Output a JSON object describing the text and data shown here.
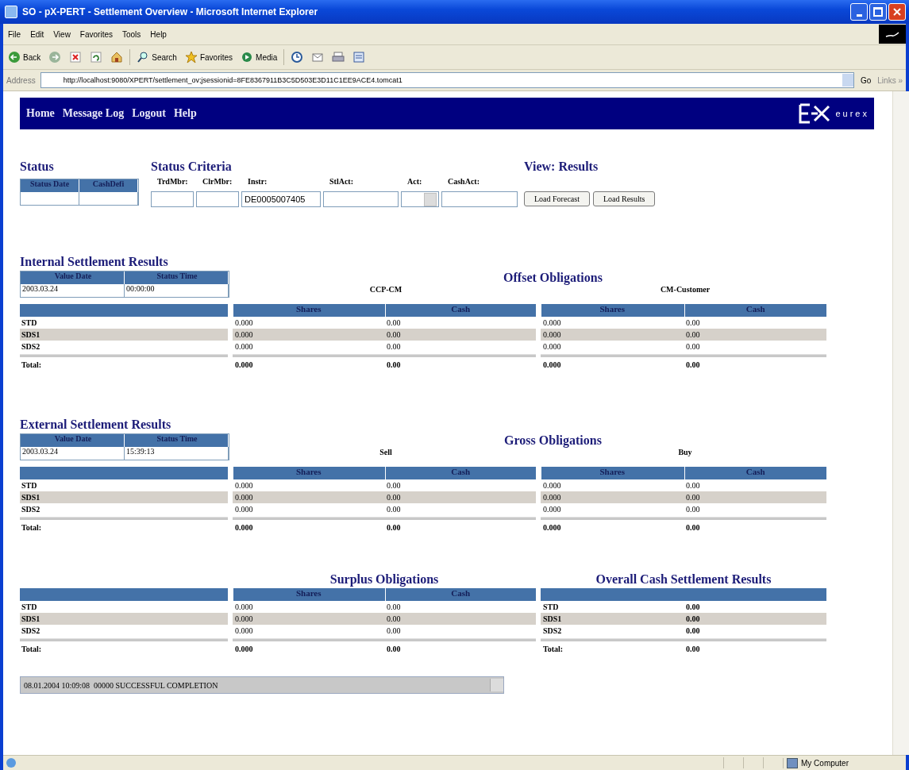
{
  "window": {
    "title": "SO - pX-PERT - Settlement Overview - Microsoft Internet Explorer"
  },
  "menu_bar": [
    "File",
    "Edit",
    "View",
    "Favorites",
    "Tools",
    "Help"
  ],
  "toolbar": [
    {
      "kind": "back",
      "label": "Back"
    },
    {
      "kind": "forward"
    },
    {
      "kind": "stop"
    },
    {
      "kind": "refresh"
    },
    {
      "kind": "home"
    },
    {
      "kind": "search",
      "label": "Search"
    },
    {
      "kind": "favorites",
      "label": "Favorites"
    },
    {
      "kind": "media",
      "label": "Media"
    },
    {
      "kind": "history"
    },
    {
      "kind": "mail"
    },
    {
      "kind": "print"
    },
    {
      "kind": "edit"
    }
  ],
  "address_bar": {
    "label": "Address",
    "url": "http://localhost:9080/XPERT/settlement_ov;jsessionid=8FE8367911B3C5D503E3D11C1EE9ACE4.tomcat1",
    "go": "Go",
    "links": "Links »"
  },
  "nav": {
    "items": [
      "Home",
      "Message Log",
      "Logout",
      "Help"
    ],
    "logo": "eurex"
  },
  "status": {
    "title": "Status",
    "columns": [
      "Status Date",
      "CashDefi"
    ]
  },
  "criteria": {
    "title": "Status Criteria",
    "fields": [
      {
        "kind": "text",
        "label": "TrdMbr:"
      },
      {
        "kind": "text",
        "label": "ClrMbr:"
      },
      {
        "kind": "text",
        "label": "Instr:",
        "value": "DE0005007405"
      },
      {
        "kind": "text",
        "label": "StlAct:"
      },
      {
        "kind": "select",
        "label": "Act:"
      },
      {
        "kind": "text",
        "label": "CashAct:"
      }
    ]
  },
  "view": {
    "title": "View: Results",
    "buttons": [
      "Load Forecast",
      "Load Results"
    ]
  },
  "sections": [
    {
      "title": "Internal Settlement Results",
      "info": {
        "columns": [
          "Value Date",
          "Status Time"
        ],
        "values": [
          "2003.03.24",
          "00:00:00"
        ]
      },
      "obligations_title": "Offset Obligations",
      "groups": [
        {
          "name": "CCP-CM",
          "columns": [
            "Shares",
            "Cash"
          ]
        },
        {
          "name": "CM-Customer",
          "columns": [
            "Shares",
            "Cash"
          ]
        }
      ],
      "rows": [
        {
          "label": "STD",
          "values": [
            "0.000",
            "0.00",
            "0.000",
            "0.00"
          ]
        },
        {
          "label": "SDS1",
          "values": [
            "0.000",
            "0.00",
            "0.000",
            "0.00"
          ]
        },
        {
          "label": "SDS2",
          "values": [
            "0.000",
            "0.00",
            "0.000",
            "0.00"
          ]
        }
      ],
      "total": {
        "label": "Total:",
        "values": [
          "0.000",
          "0.00",
          "0.000",
          "0.00"
        ]
      }
    },
    {
      "title": "External Settlement Results",
      "info": {
        "columns": [
          "Value Date",
          "Status Time"
        ],
        "values": [
          "2003.03.24",
          "15:39:13"
        ]
      },
      "obligations_title": "Gross Obligations",
      "groups": [
        {
          "name": "Sell",
          "columns": [
            "Shares",
            "Cash"
          ]
        },
        {
          "name": "Buy",
          "columns": [
            "Shares",
            "Cash"
          ]
        }
      ],
      "rows": [
        {
          "label": "STD",
          "values": [
            "0.000",
            "0.00",
            "0.000",
            "0.00"
          ]
        },
        {
          "label": "SDS1",
          "values": [
            "0.000",
            "0.00",
            "0.000",
            "0.00"
          ]
        },
        {
          "label": "SDS2",
          "values": [
            "0.000",
            "0.00",
            "0.000",
            "0.00"
          ]
        }
      ],
      "total": {
        "label": "Total:",
        "values": [
          "0.000",
          "0.00",
          "0.000",
          "0.00"
        ]
      }
    }
  ],
  "surplus": {
    "title": "Surplus Obligations",
    "columns": [
      "Shares",
      "Cash"
    ],
    "rows": [
      {
        "label": "STD",
        "values": [
          "0.000",
          "0.00"
        ]
      },
      {
        "label": "SDS1",
        "values": [
          "0.000",
          "0.00"
        ]
      },
      {
        "label": "SDS2",
        "values": [
          "0.000",
          "0.00"
        ]
      }
    ],
    "total": {
      "label": "Total:",
      "values": [
        "0.000",
        "0.00"
      ]
    }
  },
  "overall": {
    "title": "Overall Cash Settlement Results",
    "rows": [
      {
        "label": "STD",
        "value": "0.00"
      },
      {
        "label": "SDS1",
        "value": "0.00"
      },
      {
        "label": "SDS2",
        "value": "0.00"
      }
    ],
    "total": {
      "label": "Total:",
      "value": "0.00"
    }
  },
  "message": {
    "value": "08.01.2004 10:09:08  00000 SUCCESSFUL COMPLETION"
  },
  "status_bar": {
    "zone": "My Computer"
  }
}
